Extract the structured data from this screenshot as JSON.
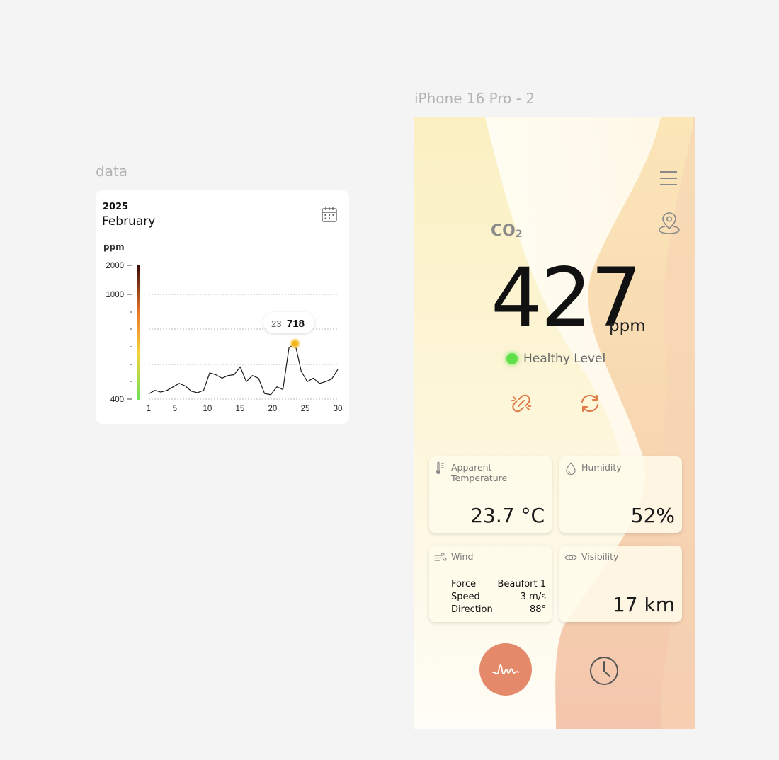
{
  "labels": {
    "data_frame": "data",
    "phone_frame": "iPhone 16 Pro - 2"
  },
  "data_card": {
    "year": "2025",
    "month": "February",
    "unit": "ppm",
    "y_ticks": [
      "2000",
      "1000",
      "400"
    ],
    "x_ticks": [
      "1",
      "5",
      "10",
      "15",
      "20",
      "25",
      "30"
    ],
    "tooltip_day": "23",
    "tooltip_value": "718"
  },
  "chart_data": {
    "type": "line",
    "x": [
      1,
      2,
      3,
      4,
      5,
      6,
      7,
      8,
      9,
      10,
      11,
      12,
      13,
      14,
      15,
      16,
      17,
      18,
      19,
      20,
      21,
      22,
      23,
      24,
      25,
      26,
      27,
      28,
      29,
      30
    ],
    "series": [
      {
        "values": [
          430,
          450,
          440,
          450,
          470,
          490,
          475,
          445,
          437,
          450,
          550,
          540,
          520,
          535,
          540,
          585,
          500,
          535,
          520,
          432,
          425,
          470,
          455,
          695,
          718,
          560,
          500,
          520,
          490,
          500,
          515,
          570
        ]
      }
    ],
    "y_ticks": [
      2000,
      1000,
      400
    ],
    "ylim": [
      400,
      2000
    ],
    "grid": "dotted horizontal",
    "highlight": {
      "x": 23,
      "value": 718
    },
    "colorbar": [
      "#6ee05a",
      "#f5d33a",
      "#e8782a",
      "#3a0a05"
    ]
  },
  "phone": {
    "pollutant": "CO",
    "pollutant_sub": "2",
    "value": "427",
    "unit": "ppm",
    "level": "Healthy Level",
    "level_color": "#5fe04a",
    "accent": "#e48a6b",
    "tiles": {
      "temperature": {
        "title": "Apparent Temperature",
        "value": "23.7 °C"
      },
      "humidity": {
        "title": "Humidity",
        "value": "52%"
      },
      "wind": {
        "title": "Wind",
        "rows": [
          {
            "label": "Force",
            "value": "Beaufort 1"
          },
          {
            "label": "Speed",
            "value": "3 m/s"
          },
          {
            "label": "Direction",
            "value": "88°"
          }
        ]
      },
      "visibility": {
        "title": "Visibility",
        "value": "17 km"
      }
    }
  }
}
